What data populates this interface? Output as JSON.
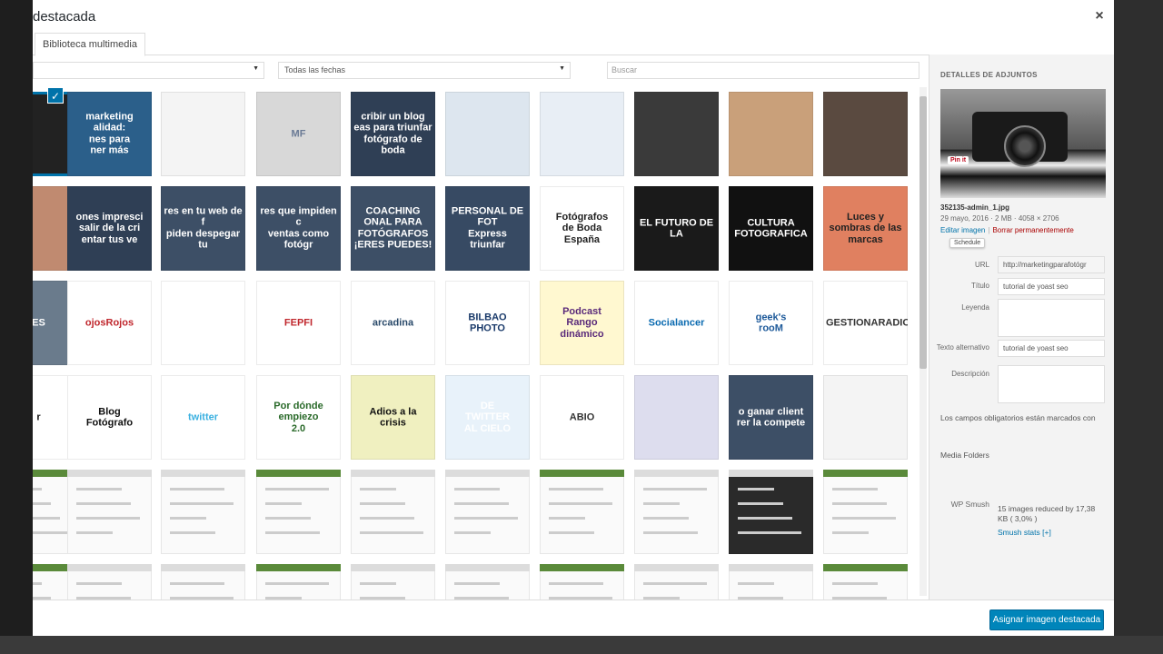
{
  "modal": {
    "title": "destacada",
    "close_glyph": "×"
  },
  "tabs": [
    {
      "label": "Biblioteca multimedia"
    }
  ],
  "filters": {
    "type_value": "",
    "date_value": "Todas las fechas",
    "search_placeholder": "Buscar"
  },
  "grid_labels": {
    "r0": [
      "",
      "marketing\nalidad:\nnes para\nner más",
      "",
      "MF",
      "cribir un blog\neas para triunfar\nfotógrafo de boda",
      "",
      "",
      "",
      "",
      ""
    ],
    "r1": [
      "",
      "ones impresci\nsalir de la cri\nentar tus ve",
      "res en tu web de f\npiden despegar tu",
      "res que impiden c\nventas como fotógr",
      "COACHING\nONAL PARA\nFOTÓGRAFOS\n¡ERES PUEDES!",
      "PERSONAL DE FOT\nExpress\ntriunfar",
      "Fotógrafos\nde Boda\nEspaña",
      "EL FUTURO DE LA",
      "CULTURA\nFOTOGRAFICA",
      "Luces y sombras de las marcas"
    ],
    "r2": [
      "ES",
      "ojosRojos",
      "",
      "FEPFI",
      "arcadina",
      "BILBAO\nPHOTO",
      "Podcast\nRango\ndinámico",
      "Socialancer",
      "geek's\nrooM",
      "GESTIONARADIO"
    ],
    "r3": [
      "r",
      "Blog\nFotógrafo",
      "twitter",
      "Por dónde\nempiezo\n2.0",
      "Adios a la\ncrisis",
      "DE\nTWITTER\nAL CIELO",
      "ABIO",
      "",
      "o ganar client\nrer la compete",
      ""
    ]
  },
  "sidebar": {
    "heading": "DETALLES DE ADJUNTOS",
    "pin_label": "Pin it",
    "filename": "352135-admin_1.jpg",
    "meta": "29 mayo, 2016 · 2 MB · 4058 × 2706",
    "edit_link": "Editar imagen",
    "separator": "|",
    "delete_link": "Borrar permanentemente",
    "schedule_tip": "Schedule",
    "fields": {
      "url_label": "URL",
      "url_value": "http://marketingparafotógr",
      "title_label": "Título",
      "title_value": "tutorial de yoast seo",
      "caption_label": "Leyenda",
      "caption_value": "",
      "alt_label": "Texto alternativo",
      "alt_value": "tutorial de yoast seo",
      "description_label": "Descripción",
      "description_value": ""
    },
    "required_note": "Los campos obligatorios están marcados con",
    "media_folders": "Media Folders",
    "smush_label": "WP Smush",
    "smush_value": "15 images reduced by 17,38 KB ( 3,0% )",
    "smush_link": "Smush stats [+]"
  },
  "footer": {
    "primary_button": "Asignar imagen destacada"
  },
  "selection_check": "✓"
}
